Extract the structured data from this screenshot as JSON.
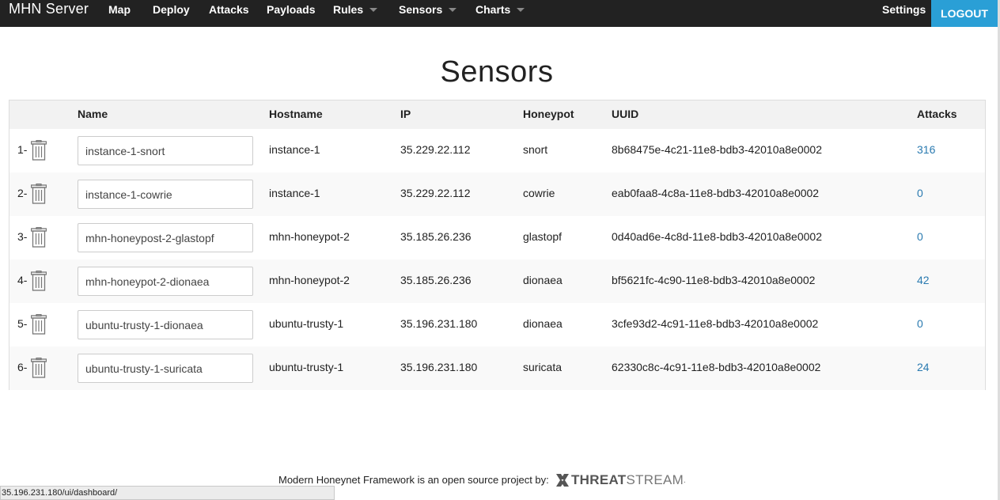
{
  "navbar": {
    "brand": "MHN Server",
    "items": [
      {
        "label": "Map",
        "dropdown": false
      },
      {
        "label": "Deploy",
        "dropdown": false
      },
      {
        "label": "Attacks",
        "dropdown": false
      },
      {
        "label": "Payloads",
        "dropdown": false
      },
      {
        "label": "Rules",
        "dropdown": true
      },
      {
        "label": "Sensors",
        "dropdown": true
      },
      {
        "label": "Charts",
        "dropdown": true
      }
    ],
    "settings": "Settings",
    "logout": "LOGOUT"
  },
  "page": {
    "title": "Sensors"
  },
  "table": {
    "headers": {
      "name": "Name",
      "hostname": "Hostname",
      "ip": "IP",
      "honeypot": "Honeypot",
      "uuid": "UUID",
      "attacks": "Attacks"
    },
    "rows": [
      {
        "num": "1-",
        "name": "instance-1-snort",
        "hostname": "instance-1",
        "ip": "35.229.22.112",
        "honeypot": "snort",
        "uuid": "8b68475e-4c21-11e8-bdb3-42010a8e0002",
        "attacks": "316"
      },
      {
        "num": "2-",
        "name": "instance-1-cowrie",
        "hostname": "instance-1",
        "ip": "35.229.22.112",
        "honeypot": "cowrie",
        "uuid": "eab0faa8-4c8a-11e8-bdb3-42010a8e0002",
        "attacks": "0"
      },
      {
        "num": "3-",
        "name": "mhn-honeypost-2-glastopf",
        "hostname": "mhn-honeypot-2",
        "ip": "35.185.26.236",
        "honeypot": "glastopf",
        "uuid": "0d40ad6e-4c8d-11e8-bdb3-42010a8e0002",
        "attacks": "0"
      },
      {
        "num": "4-",
        "name": "mhn-honeypot-2-dionaea",
        "hostname": "mhn-honeypot-2",
        "ip": "35.185.26.236",
        "honeypot": "dionaea",
        "uuid": "bf5621fc-4c90-11e8-bdb3-42010a8e0002",
        "attacks": "42"
      },
      {
        "num": "5-",
        "name": "ubuntu-trusty-1-dionaea",
        "hostname": "ubuntu-trusty-1",
        "ip": "35.196.231.180",
        "honeypot": "dionaea",
        "uuid": "3cfe93d2-4c91-11e8-bdb3-42010a8e0002",
        "attacks": "0"
      },
      {
        "num": "6-",
        "name": "ubuntu-trusty-1-suricata",
        "hostname": "ubuntu-trusty-1",
        "ip": "35.196.231.180",
        "honeypot": "suricata",
        "uuid": "62330c8c-4c91-11e8-bdb3-42010a8e0002",
        "attacks": "24"
      }
    ]
  },
  "footer": {
    "text": "Modern Honeynet Framework is an open source project by:",
    "logo_threat": "THREAT",
    "logo_stream": "STREAM",
    "logo_dot": "."
  },
  "status_bar": {
    "url": "35.196.231.180/ui/dashboard/"
  },
  "colors": {
    "navbar_bg": "#222222",
    "accent": "#2a9fd6",
    "link": "#2a7ab0"
  }
}
